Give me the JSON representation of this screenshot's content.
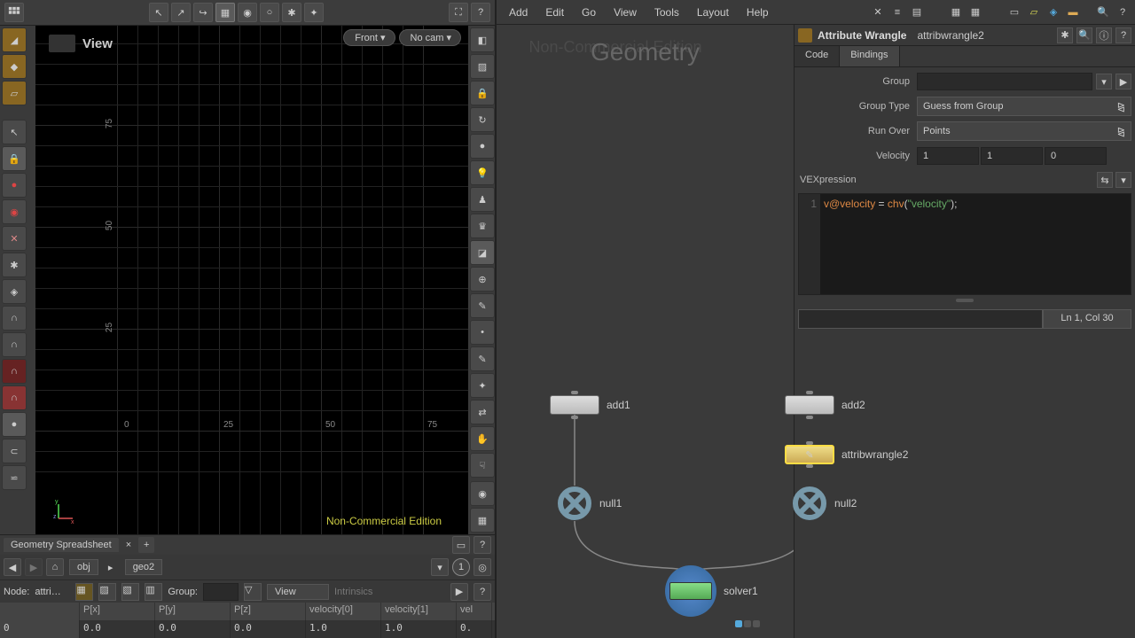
{
  "menubar": {
    "items": [
      "Add",
      "Edit",
      "Go",
      "View",
      "Tools",
      "Layout",
      "Help"
    ]
  },
  "viewport": {
    "label": "View",
    "dropdown1": "Front",
    "dropdown2": "No cam",
    "nc_edition": "Non-Commercial Edition",
    "grid_x_labels": [
      "0",
      "25",
      "50",
      "75"
    ],
    "grid_y_labels": [
      "75",
      "50",
      "25"
    ]
  },
  "network": {
    "title": "Geometry",
    "nc_title": "Non-Commercial Edition",
    "nodes": {
      "add1": "add1",
      "add2": "add2",
      "attribwrangle2": "attribwrangle2",
      "null1": "null1",
      "null2": "null2",
      "solver1": "solver1"
    }
  },
  "params": {
    "node_type": "Attribute Wrangle",
    "node_name": "attribwrangle2",
    "tabs": {
      "code": "Code",
      "bindings": "Bindings"
    },
    "group": {
      "label": "Group",
      "value": ""
    },
    "group_type": {
      "label": "Group Type",
      "value": "Guess from Group"
    },
    "run_over": {
      "label": "Run Over",
      "value": "Points"
    },
    "velocity": {
      "label": "Velocity",
      "x": "1",
      "y": "1",
      "z": "0"
    },
    "vex_label": "VEXpression",
    "vex_line_no": "1",
    "vex_code": {
      "attr": "v@velocity",
      "eq": " = ",
      "func": "chv",
      "paren_l": "(",
      "str": "\"velocity\"",
      "paren_r": ");",
      "full": "v@velocity = chv(\"velocity\");"
    },
    "cursor_pos": "Ln 1, Col 30"
  },
  "spreadsheet": {
    "tab": "Geometry Spreadsheet",
    "path": {
      "obj": "obj",
      "geo2": "geo2"
    },
    "node_label": "Node:",
    "node_value": "attri…",
    "group_label": "Group:",
    "view_dd": "View",
    "intrinsics": "Intrinsics",
    "headers": [
      "",
      "P[x]",
      "P[y]",
      "P[z]",
      "velocity[0]",
      "velocity[1]",
      "vel"
    ],
    "row": [
      "0",
      "0.0",
      "0.0",
      "0.0",
      "1.0",
      "1.0",
      "0."
    ]
  }
}
